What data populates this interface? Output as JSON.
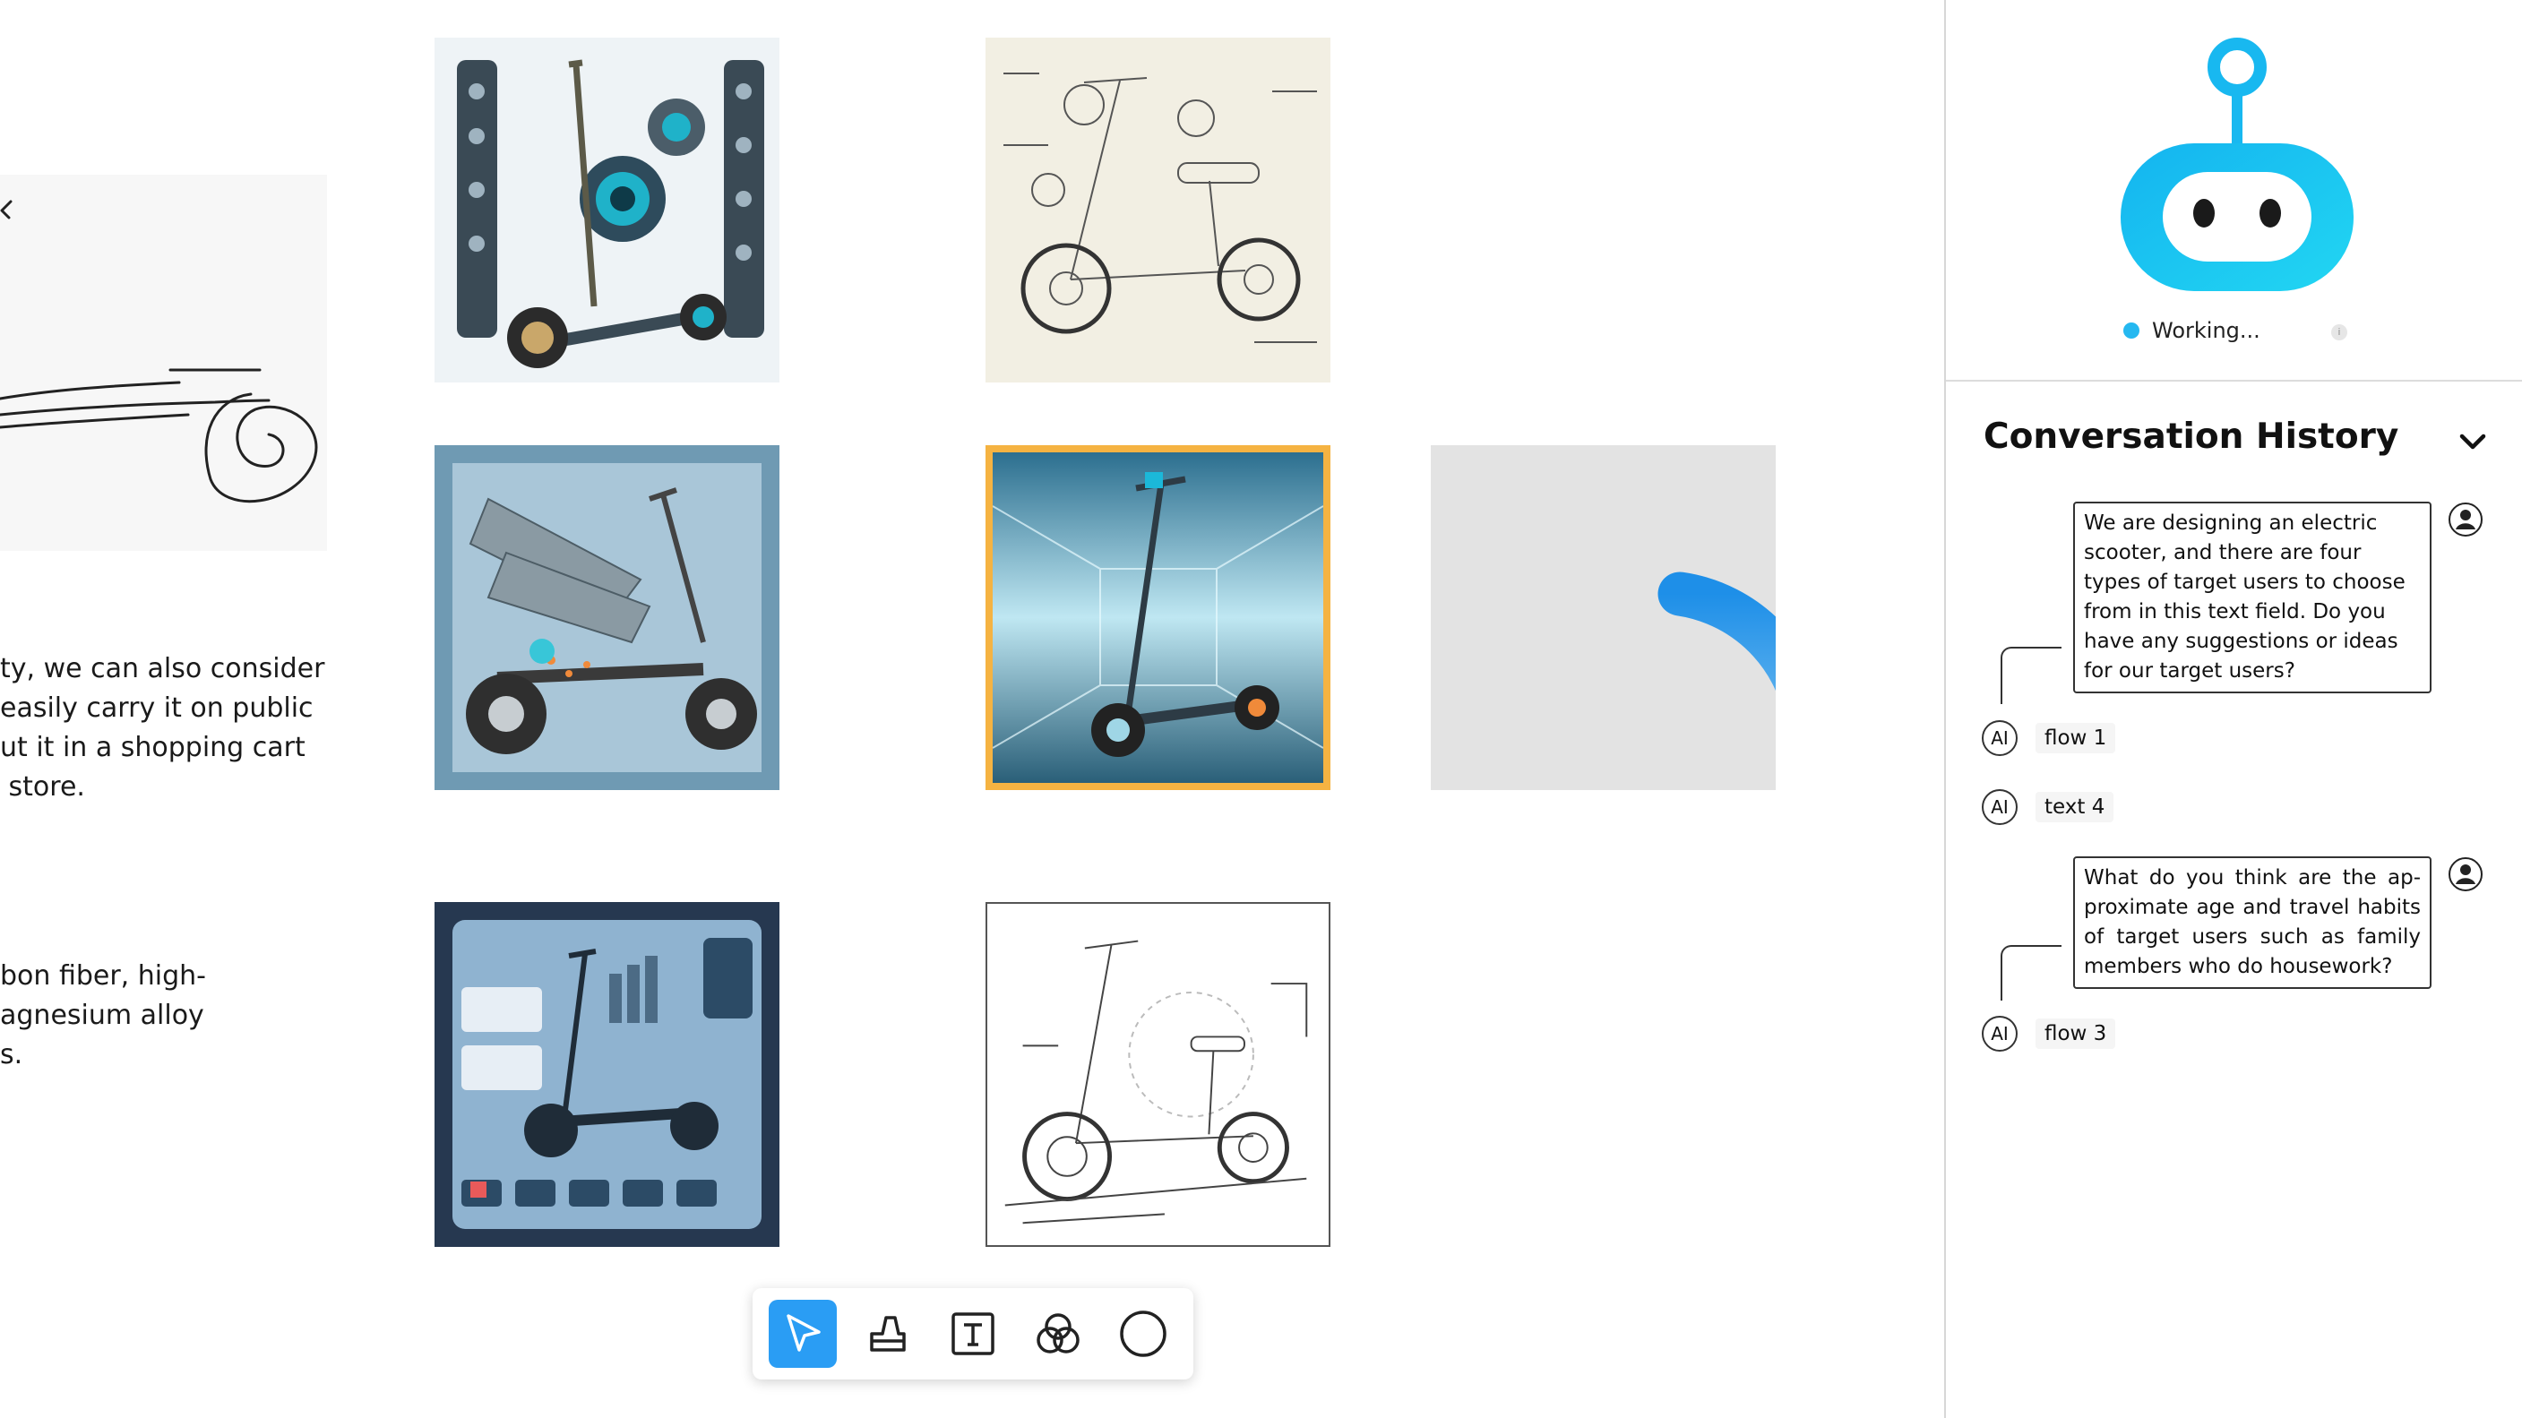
{
  "canvas": {
    "notes": [
      "ty, we can also consider\neasily carry it on public\nut it in a shopping cart\n store.",
      "bon fiber, high-\nagnesium alloy\ns."
    ],
    "images": [
      {
        "name": "scooter-concept-ui-panels",
        "state": "normal"
      },
      {
        "name": "scooter-technical-sketch",
        "state": "normal"
      },
      {
        "name": "scooter-wing-explosion",
        "state": "normal"
      },
      {
        "name": "scooter-futuristic-corridor",
        "state": "selected"
      },
      {
        "name": "scooter-generating",
        "state": "loading"
      },
      {
        "name": "scooter-infographic",
        "state": "normal"
      },
      {
        "name": "scooter-line-drawing",
        "state": "normal"
      }
    ]
  },
  "toolbar": {
    "tools": [
      {
        "icon": "pointer-icon",
        "active": true
      },
      {
        "icon": "eraser-icon",
        "active": false
      },
      {
        "icon": "text-tool-icon",
        "active": false
      },
      {
        "icon": "shapes-icon",
        "active": false
      },
      {
        "icon": "circle-icon",
        "active": false
      }
    ]
  },
  "agent": {
    "status": "Working...",
    "status_color": "#25b8f0",
    "info_icon": "i",
    "robot_color": "#1fc0f0"
  },
  "history": {
    "title": "Conversation History",
    "messages": [
      {
        "role": "user",
        "text": "We are designing an electric scooter, and there are four types of target users to choose from in this text field. Do you have any suggestions or ideas for our target users?"
      },
      {
        "role": "ai",
        "badge": "AI",
        "text": "flow 1"
      },
      {
        "role": "ai",
        "badge": "AI",
        "text": "text 4"
      },
      {
        "role": "user",
        "text": "What do you think are the ap-proximate age and travel habits of target users such as family members who do housework?"
      },
      {
        "role": "ai",
        "badge": "AI",
        "text": "flow 3"
      }
    ]
  }
}
